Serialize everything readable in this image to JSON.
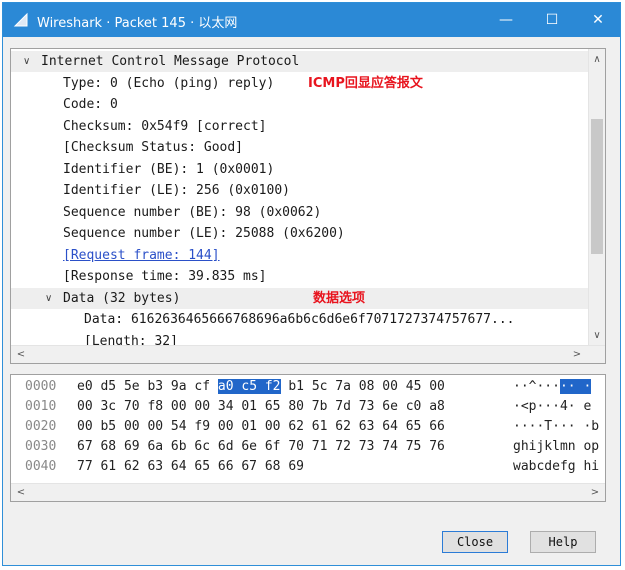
{
  "window": {
    "title": "Wireshark · Packet 145 · 以太网",
    "minimize_glyph": "—",
    "maximize_glyph": "☐",
    "close_glyph": "✕"
  },
  "tree": {
    "rows": [
      {
        "text": "Internet Control Message Protocol",
        "expander": "∨",
        "link": false
      },
      {
        "text": "Type: 0 (Echo (ping) reply)",
        "expander": "",
        "link": false
      },
      {
        "text": "Code: 0",
        "expander": "",
        "link": false
      },
      {
        "text": "Checksum: 0x54f9 [correct]",
        "expander": "",
        "link": false
      },
      {
        "text": "[Checksum Status: Good]",
        "expander": "",
        "link": false
      },
      {
        "text": "Identifier (BE): 1 (0x0001)",
        "expander": "",
        "link": false
      },
      {
        "text": "Identifier (LE): 256 (0x0100)",
        "expander": "",
        "link": false
      },
      {
        "text": "Sequence number (BE): 98 (0x0062)",
        "expander": "",
        "link": false
      },
      {
        "text": "Sequence number (LE): 25088 (0x6200)",
        "expander": "",
        "link": false
      },
      {
        "text": "[Request frame: 144]",
        "expander": "",
        "link": true
      },
      {
        "text": "[Response time: 39.835 ms]",
        "expander": "",
        "link": false
      },
      {
        "text": "Data (32 bytes)",
        "expander": "∨",
        "link": false
      },
      {
        "text": "Data: 6162636465666768696a6b6c6d6e6f7071727374757677...",
        "expander": "",
        "link": false
      },
      {
        "text": "[Length: 32]",
        "expander": "",
        "link": false
      }
    ],
    "annotations": {
      "icmp_reply": "ICMP回显应答报文",
      "data_option": "数据选项"
    },
    "scroll_up": "∧",
    "scroll_down": "∨",
    "scroll_left": "<",
    "scroll_right": ">"
  },
  "hex": {
    "rows": [
      {
        "offset": "0000",
        "pre": "e0 d5 5e b3 9a cf ",
        "hl": "a0 c5  f2",
        "post": " b1 5c 7a 08 00 45 00",
        "ascii_pre": "··^···",
        "ascii_hl": "·· ·",
        "ascii_post": ""
      },
      {
        "offset": "0010",
        "pre": "00 3c 70 f8 00 00 34 01  65 80 7b 7d 73 6e c0 a8",
        "hl": "",
        "post": "",
        "ascii_pre": "·<p···4· e",
        "ascii_hl": "",
        "ascii_post": ""
      },
      {
        "offset": "0020",
        "pre": "00 b5 00 00 54 f9 00 01  00 62 61 62 63 64 65 66",
        "hl": "",
        "post": "",
        "ascii_pre": "····T··· ·b",
        "ascii_hl": "",
        "ascii_post": ""
      },
      {
        "offset": "0030",
        "pre": "67 68 69 6a 6b 6c 6d 6e  6f 70 71 72 73 74 75 76",
        "hl": "",
        "post": "",
        "ascii_pre": "ghijklmn op",
        "ascii_hl": "",
        "ascii_post": ""
      },
      {
        "offset": "0040",
        "pre": "77 61 62 63 64 65 66 67  68 69",
        "hl": "",
        "post": "",
        "ascii_pre": "wabcdefg hi",
        "ascii_hl": "",
        "ascii_post": ""
      }
    ],
    "scroll_left": "<",
    "scroll_right": ">"
  },
  "buttons": {
    "close": "Close",
    "help": "Help"
  },
  "colors": {
    "titlebar": "#2b89d6",
    "annotation": "#e8141e",
    "link": "#2b50c8",
    "selection": "#2166c9"
  }
}
